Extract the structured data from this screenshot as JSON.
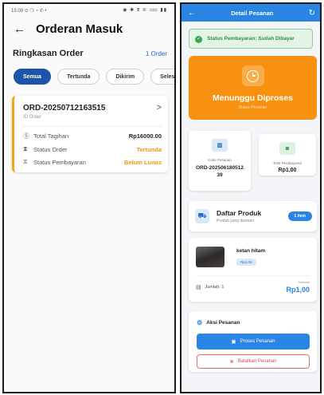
{
  "left": {
    "status_bar": {
      "time": "15.09",
      "left_icons": "⊙ ❍ ◔ ✆ •",
      "right_icons": "◉ ✱ ⩨ ≋ ⩶ ▮▮"
    },
    "header": {
      "back_icon": "arrow-left-icon",
      "title": "Orderan Masuk"
    },
    "summary": {
      "title": "Ringkasan Order",
      "count": "1 Order"
    },
    "filters": [
      "Semua",
      "Tertunda",
      "Dikirim",
      "Selesai"
    ],
    "active_filter": "Semua",
    "order": {
      "id": "ORD-20250712163515",
      "id_label": "ID Order",
      "total_label": "Total Tagihan",
      "total_value": "Rp16000.00",
      "order_status_label": "Status Order",
      "order_status_value": "Tertunda",
      "payment_status_label": "Status Pembayaran",
      "payment_status_value": "Belum Lunas"
    }
  },
  "right": {
    "header": {
      "title": "Detail Pesanan",
      "back_icon": "arrow-left-icon",
      "refresh_icon": "refresh-icon"
    },
    "payment_banner": "Status Pembayaran: Sudah Dibayar",
    "status_card": {
      "title": "Menunggu Diproses",
      "subtitle": "Status Pesanan"
    },
    "code_card": {
      "label": "Kode Pesanan",
      "value": "ORD-20250618051239"
    },
    "total_card": {
      "label": "Total Pembayaran",
      "value": "Rp1,00"
    },
    "products_header": {
      "title": "Daftar Produk",
      "subtitle": "Produk yang dipesan",
      "badge": "1 item"
    },
    "product": {
      "name": "ketan hitam",
      "price": "Rp1,00",
      "qty_label": "Jumlah: 1",
      "subtotal_label": "Subtotal",
      "subtotal_value": "Rp1,00"
    },
    "actions": {
      "title": "Aksi Pesanan",
      "process_label": "Proses Pesanan",
      "cancel_label": "Batalkan Pesanan"
    }
  },
  "colors": {
    "primary": "#2a84e4",
    "nav_blue": "#1d54a8",
    "orange": "#f7910f",
    "success": "#3aa655",
    "danger": "#d84a4a"
  }
}
